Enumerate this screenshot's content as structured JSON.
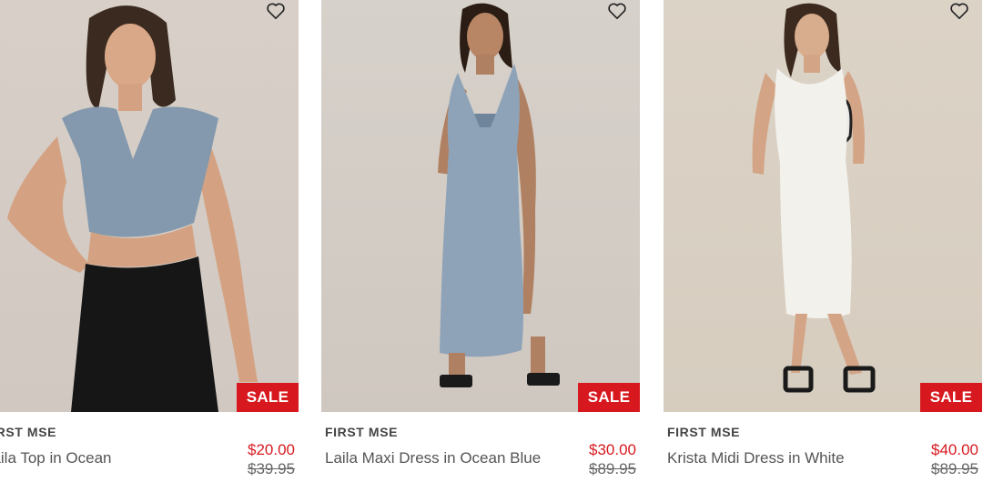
{
  "products": [
    {
      "brand": "FIRST MSE",
      "name": "Laila Top in Ocean",
      "sale_price": "$20.00",
      "original_price": "$39.95",
      "badge": "SALE"
    },
    {
      "brand": "FIRST MSE",
      "name": "Laila Maxi Dress in Ocean Blue",
      "sale_price": "$30.00",
      "original_price": "$89.95",
      "badge": "SALE"
    },
    {
      "brand": "FIRST MSE",
      "name": "Krista Midi Dress in White",
      "sale_price": "$40.00",
      "original_price": "$89.95",
      "badge": "SALE"
    }
  ],
  "icons": {
    "wishlist": "heart-outline-icon"
  },
  "colors": {
    "sale_badge": "#d7191f",
    "sale_price": "#d7191f",
    "text": "#555555"
  }
}
